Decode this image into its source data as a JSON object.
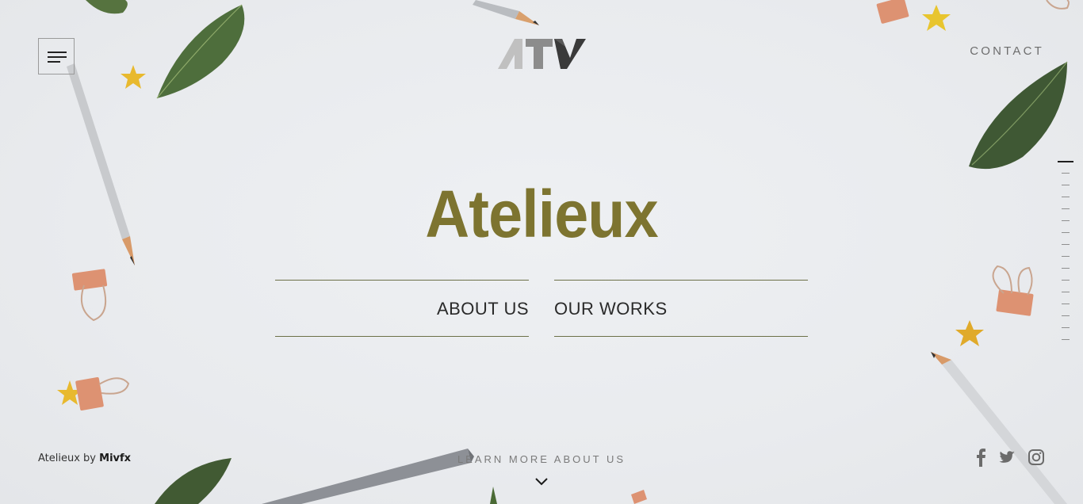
{
  "header": {
    "menu_icon": "hamburger-icon",
    "logo_text": "ATV",
    "contact_label": "CONTACT"
  },
  "hero": {
    "title": "Atelieux",
    "nav": {
      "about_label": "ABOUT US",
      "works_label": "OUR WORKS"
    }
  },
  "footer": {
    "credit_prefix": "Atelieux by",
    "credit_author": "Mivfx",
    "learn_more_label": "LEARN MORE ABOUT US",
    "scroll_icon": "chevron-down-icon",
    "social": [
      "facebook-icon",
      "twitter-icon",
      "instagram-icon"
    ]
  },
  "scroll_indicator": {
    "total_sections": 16,
    "active_section": 1
  },
  "colors": {
    "title": "#7d7430",
    "nav_rule": "#6c7048",
    "logo_light": "#c0c0c0",
    "logo_mid": "#8c8c8c",
    "logo_dark": "#3a3a3a",
    "leaf": "#4d6b3a",
    "star": "#e8b92e",
    "clip": "#d98b66"
  }
}
